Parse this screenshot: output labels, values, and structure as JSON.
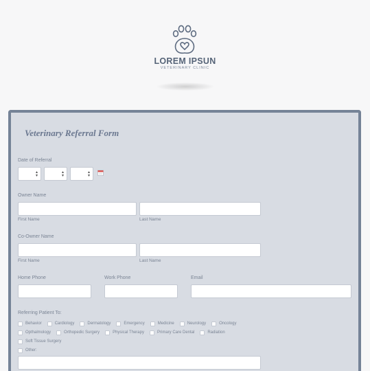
{
  "brand": {
    "name": "LOREM IPSUN",
    "subtitle": "VETERINARY CLINIC"
  },
  "form": {
    "title": "Veterinary Referral Form",
    "date_of_referral": {
      "label": "Date of Referral",
      "selects": [
        "",
        "",
        ""
      ]
    },
    "owner_name": {
      "label": "Owner Name",
      "first_label": "First Name",
      "last_label": "Last Name",
      "first_value": "",
      "last_value": ""
    },
    "co_owner_name": {
      "label": "Co-Owner Name",
      "first_label": "First Name",
      "last_label": "Last Name",
      "first_value": "",
      "last_value": ""
    },
    "home_phone": {
      "label": "Home Phone",
      "value": ""
    },
    "work_phone": {
      "label": "Work Phone",
      "value": ""
    },
    "email": {
      "label": "Email",
      "value": ""
    },
    "referring_patient": {
      "label": "Referring Patient To:",
      "row1": [
        "Behavior",
        "Cardiology",
        "Dermatology",
        "Emergency",
        "Medicine",
        "Neurology",
        "Oncology"
      ],
      "row2": [
        "Opthalmology",
        "Orthopedic Surgery",
        "Physical Therapy",
        "Primary Care Dental",
        "Radiation"
      ],
      "row3": [
        "Soft Tissue Surgery"
      ],
      "row4": [
        "Other:"
      ],
      "other_value": ""
    }
  },
  "colors": {
    "page_bg": "#f7f7f8",
    "card_bg": "#d8dce3",
    "card_border": "#758397",
    "brand_text": "#566478"
  },
  "icons": {
    "logo": "paw-heart-icon",
    "calendar": "calendar-icon",
    "select_arrows": "chevron-updown-icon"
  }
}
